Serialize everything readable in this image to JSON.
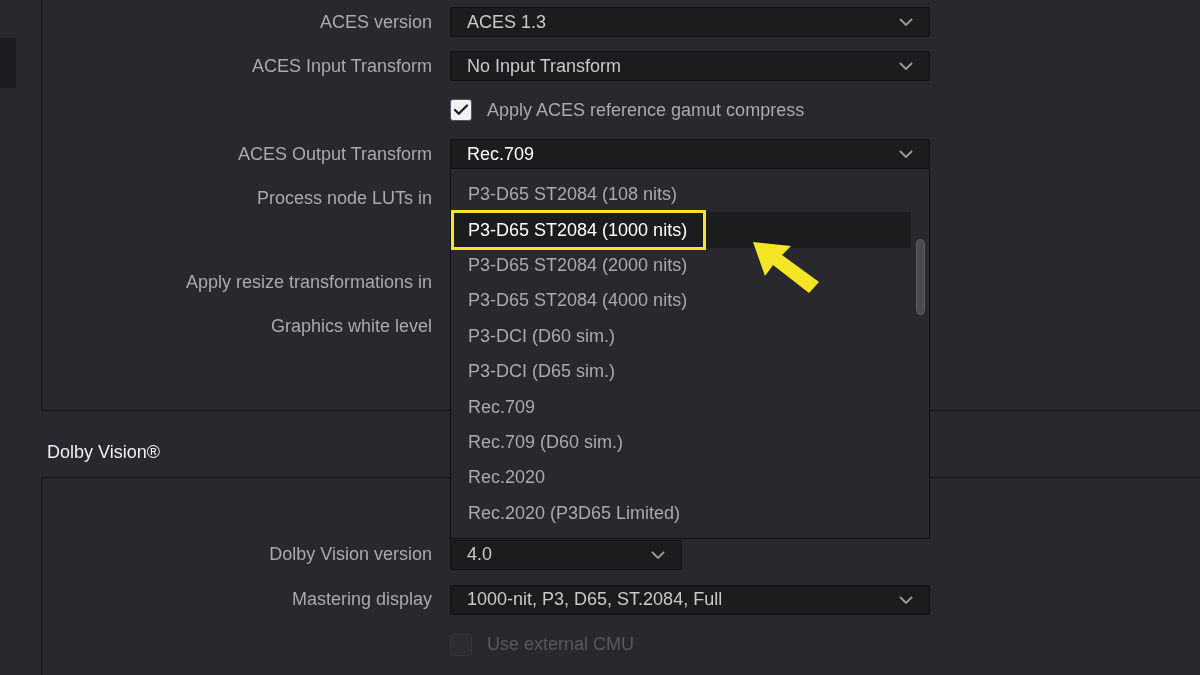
{
  "aces": {
    "rows": [
      {
        "kind": "select",
        "label": "ACES version",
        "value": "ACES 1.3",
        "expanded": false
      },
      {
        "kind": "select",
        "label": "ACES Input Transform",
        "value": "No Input Transform",
        "expanded": false
      },
      {
        "kind": "checkbox",
        "label": "Apply ACES reference gamut compress",
        "checked": true,
        "disabled": false
      },
      {
        "kind": "select",
        "label": "ACES Output Transform",
        "value": "Rec.709",
        "expanded": true,
        "options": [
          {
            "label": "P3-D65 ST2084 (108 nits)",
            "highlighted": false,
            "callout": false
          },
          {
            "label": "P3-D65 ST2084 (1000 nits)",
            "highlighted": true,
            "callout": true
          },
          {
            "label": "P3-D65 ST2084 (2000 nits)",
            "highlighted": false,
            "callout": false
          },
          {
            "label": "P3-D65 ST2084 (4000 nits)",
            "highlighted": false,
            "callout": false
          },
          {
            "label": "P3-DCI (D60 sim.)",
            "highlighted": false,
            "callout": false
          },
          {
            "label": "P3-DCI (D65 sim.)",
            "highlighted": false,
            "callout": false
          },
          {
            "label": "Rec.709",
            "highlighted": false,
            "callout": false
          },
          {
            "label": "Rec.709 (D60 sim.)",
            "highlighted": false,
            "callout": false
          },
          {
            "label": "Rec.2020",
            "highlighted": false,
            "callout": false
          },
          {
            "label": "Rec.2020 (P3D65 Limited)",
            "highlighted": false,
            "callout": false
          }
        ]
      },
      {
        "kind": "covered",
        "label": "Process node LUTs in"
      },
      {
        "kind": "covered",
        "label": "Apply resize transformations in"
      },
      {
        "kind": "covered",
        "label": "Graphics white level"
      }
    ]
  },
  "dolby": {
    "title": "Dolby Vision®",
    "rows": [
      {
        "kind": "short-select",
        "label": "Dolby Vision version",
        "value": "4.0",
        "expanded": false
      },
      {
        "kind": "select",
        "label": "Mastering display",
        "value": "1000-nit, P3, D65, ST.2084, Full",
        "expanded": false
      },
      {
        "kind": "checkbox",
        "label": "Use external CMU",
        "checked": false,
        "disabled": true
      }
    ]
  }
}
